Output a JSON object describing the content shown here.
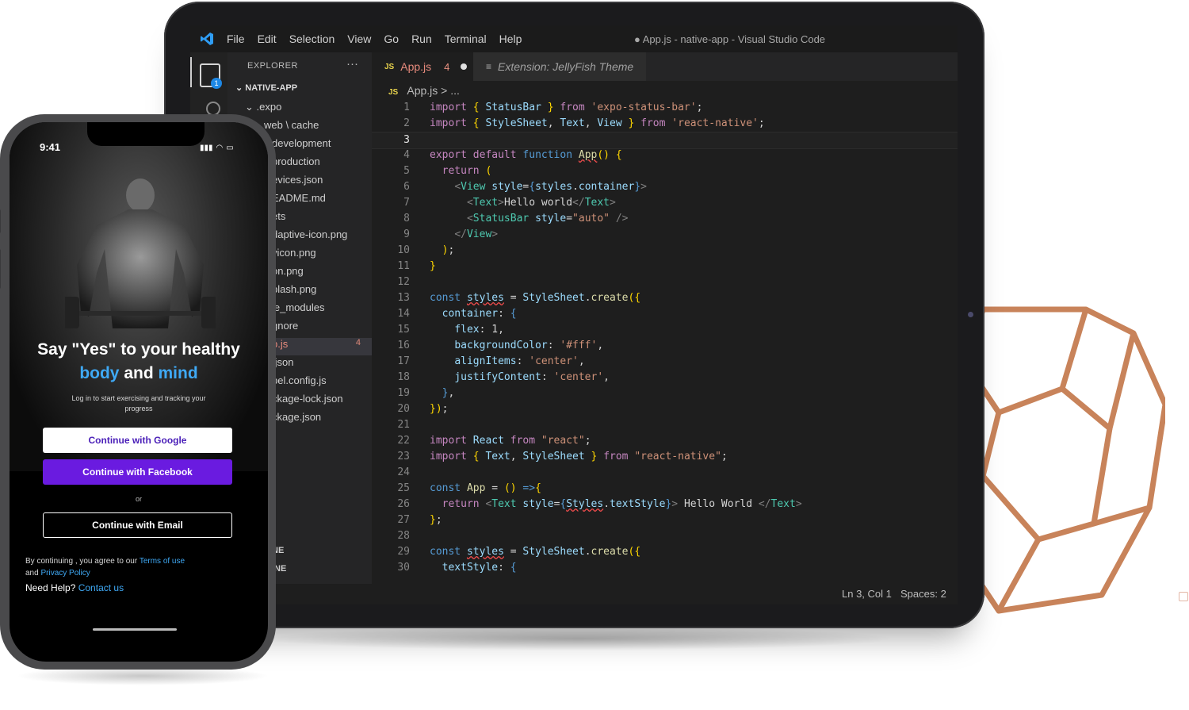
{
  "colors": {
    "accent_blue": "#3fa9f5",
    "facebook_purple": "#6a1be0",
    "google_text": "#4a1fb8",
    "editor_bg": "#1e1e1e",
    "copper": "#c8835a"
  },
  "vscode": {
    "menu": [
      "File",
      "Edit",
      "Selection",
      "View",
      "Go",
      "Run",
      "Terminal",
      "Help"
    ],
    "window_title": "● App.js - native-app - Visual Studio Code",
    "activity_badge": "1",
    "explorer": {
      "header": "EXPLORER",
      "more": "···",
      "root": "NATIVE-APP",
      "items": [
        ".expo",
        "web \\ cache",
        "development",
        "production",
        "evices.json",
        "EADME.md",
        "ets",
        "daptive-icon.png",
        "vicon.png",
        "on.png",
        "plash.png",
        "le_modules",
        "gnore",
        "p.js",
        ".json",
        "bel.config.js",
        "ckage-lock.json",
        "ckage.json"
      ],
      "active_badge": "4",
      "outline": "NE",
      "timeline": "INE"
    },
    "tabs": [
      {
        "icon": "JS",
        "label": "App.js",
        "badge": "4"
      },
      {
        "icon": "≡",
        "label": "Extension: JellyFish Theme"
      }
    ],
    "breadcrumb": {
      "icon": "JS",
      "file": "App.js",
      "rest": " > ..."
    },
    "line_numbers": [
      "1",
      "2",
      "3",
      "4",
      "5",
      "6",
      "7",
      "8",
      "9",
      "10",
      "11",
      "12",
      "13",
      "14",
      "15",
      "16",
      "17",
      "18",
      "19",
      "20",
      "21",
      "22",
      "23",
      "24",
      "25",
      "26",
      "27",
      "28",
      "29",
      "30"
    ],
    "status": {
      "position": "Ln 3, Col 1",
      "spaces": "Spaces: 2"
    }
  },
  "phone": {
    "time": "9:41",
    "headline_1": "Say \"Yes\" to your healthy",
    "headline_2_a": "body",
    "headline_2_b": " and ",
    "headline_2_c": "mind",
    "subtitle": "Log in to start exercising and tracking your progress",
    "google_button": "Continue with Google",
    "facebook_button": "Continue with Facebook",
    "or": "or",
    "email_button": "Continue with Email",
    "terms_prefix": "By continuing , you agree to our ",
    "terms_link": "Terms of use",
    "terms_and": "and ",
    "privacy_link": "Privacy Policy",
    "help_prefix": "Need Help? ",
    "help_link": "Contact us"
  }
}
